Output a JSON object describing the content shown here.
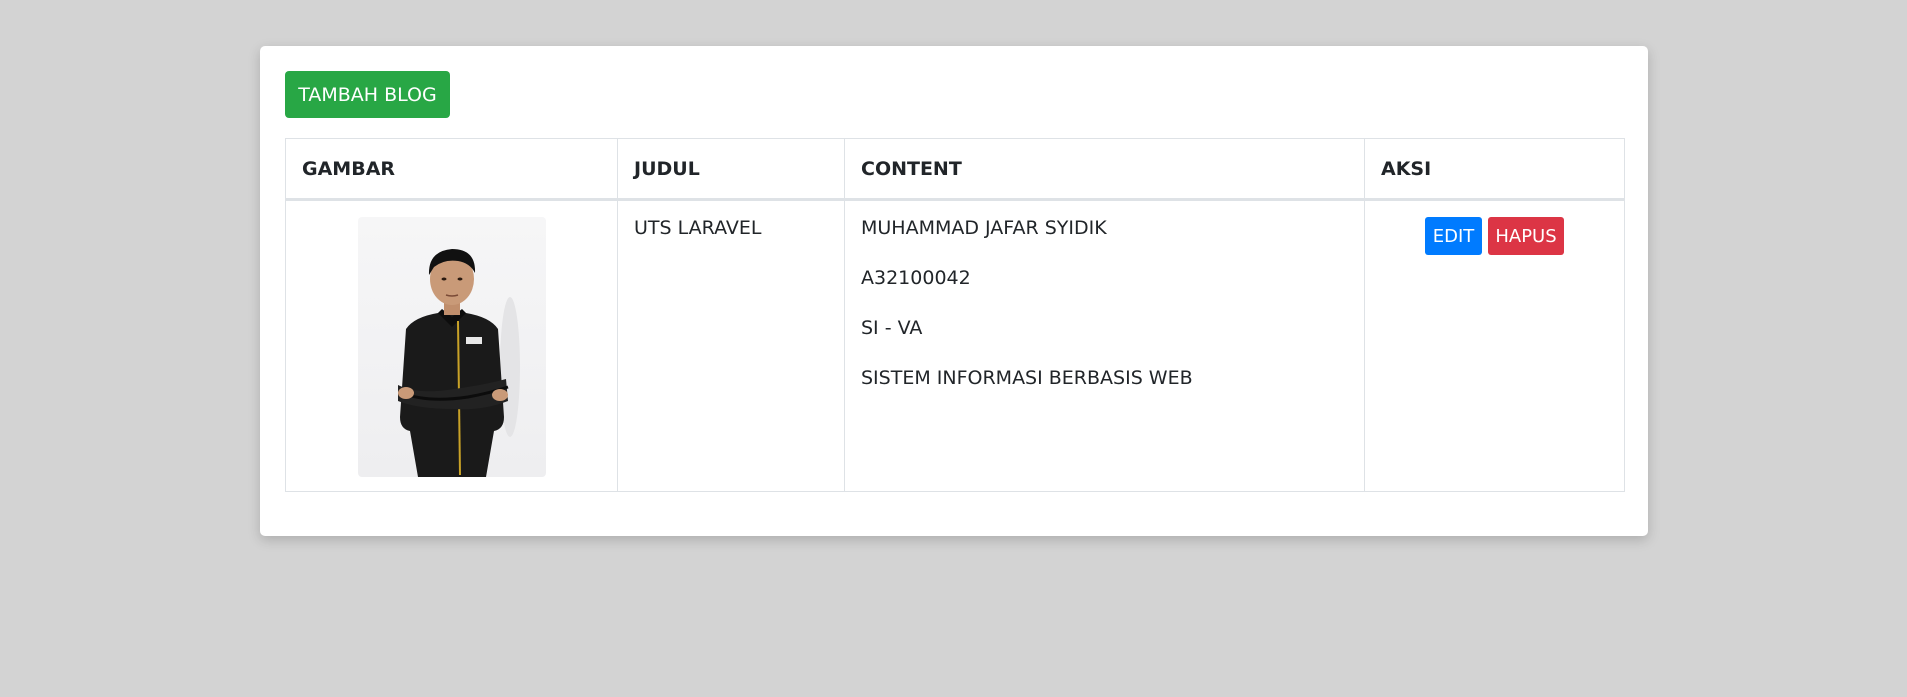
{
  "toolbar": {
    "add_label": "TAMBAH BLOG",
    "add_color": "#28a745"
  },
  "table": {
    "headers": [
      "GAMBAR",
      "JUDUL",
      "CONTENT",
      "AKSI"
    ],
    "rows": [
      {
        "image": "profile-photo",
        "title": "UTS LARAVEL",
        "content": [
          "MUHAMMAD JAFAR SYIDIK",
          "A32100042",
          "SI - VA",
          "SISTEM INFORMASI BERBASIS WEB"
        ],
        "actions": {
          "edit_label": "EDIT",
          "edit_color": "#007bff",
          "delete_label": "HAPUS",
          "delete_color": "#dc3545"
        }
      }
    ]
  },
  "colors": {
    "background": "#d3d3d3",
    "card": "#ffffff",
    "border": "#dee2e6"
  }
}
